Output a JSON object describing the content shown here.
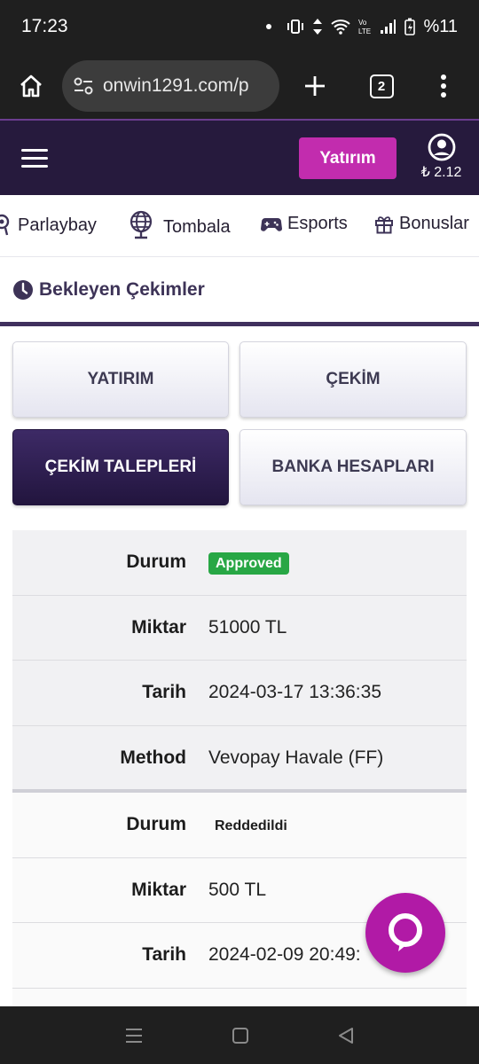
{
  "status_bar": {
    "time": "17:23",
    "battery": "%11",
    "icons": [
      "notification-dot",
      "vibrate-icon",
      "data-arrows-icon",
      "wifi-icon",
      "volte-icon",
      "signal-icon",
      "battery-icon"
    ]
  },
  "browser": {
    "url": "onwin1291.com/p",
    "tab_count": "2",
    "icons": [
      "home-icon",
      "site-settings-icon",
      "new-tab-plus-icon",
      "tab-switcher-icon",
      "more-vert-icon"
    ]
  },
  "header": {
    "deposit_label": "Yatırım",
    "balance": "₺ 2.12",
    "accent_color": "#c22cae",
    "background_color": "#261a3d"
  },
  "categories": [
    {
      "label": "Parlaybay",
      "icon": "parlay-icon"
    },
    {
      "label": "Tombala",
      "icon": "globe-icon"
    },
    {
      "label": "Esports",
      "icon": "gamepad-icon"
    },
    {
      "label": "Bonuslar",
      "icon": "gift-icon"
    }
  ],
  "section": {
    "title": "Bekleyen Çekimler",
    "icon": "clock-icon"
  },
  "buttons": {
    "deposit": "YATIRIM",
    "withdraw": "ÇEKİM",
    "withdraw_requests": "ÇEKİM TALEPLERİ",
    "bank_accounts": "BANKA HESAPLARI"
  },
  "labels": {
    "status": "Durum",
    "amount": "Miktar",
    "date": "Tarih",
    "method": "Method"
  },
  "records": [
    {
      "status": "Approved",
      "amount": "51000 TL",
      "date": "2024-03-17 13:36:35",
      "method": "Vevopay Havale (FF)"
    },
    {
      "status": "Reddedildi",
      "amount": "500 TL",
      "date": "2024-02-09 20:49:",
      "method": ""
    }
  ],
  "chat": {
    "icon": "chat-bubble-icon"
  },
  "android_nav": {
    "icons": [
      "recent-apps-icon",
      "home-square-icon",
      "back-triangle-icon"
    ]
  }
}
